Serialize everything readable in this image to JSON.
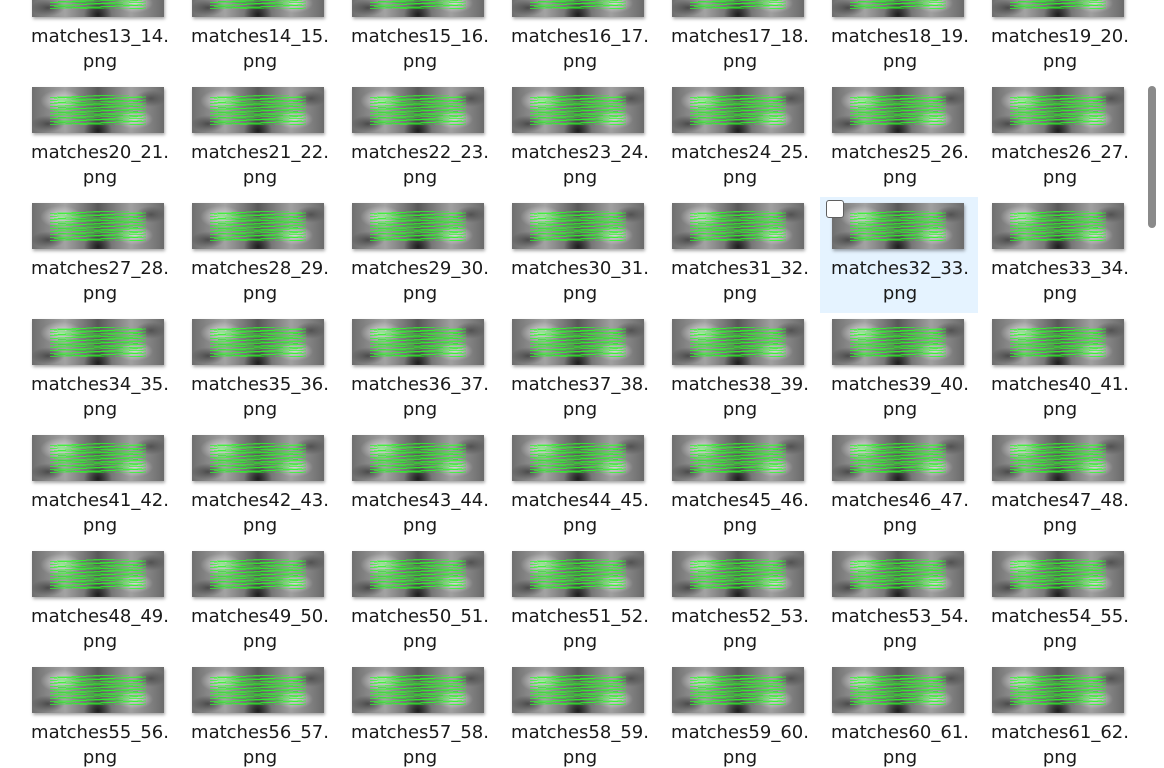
{
  "files": [
    {
      "name": "matches13_14.",
      "ext": "png"
    },
    {
      "name": "matches14_15.",
      "ext": "png"
    },
    {
      "name": "matches15_16.",
      "ext": "png"
    },
    {
      "name": "matches16_17.",
      "ext": "png"
    },
    {
      "name": "matches17_18.",
      "ext": "png"
    },
    {
      "name": "matches18_19.",
      "ext": "png"
    },
    {
      "name": "matches19_20.",
      "ext": "png"
    },
    {
      "name": "matches20_21.",
      "ext": "png"
    },
    {
      "name": "matches21_22.",
      "ext": "png"
    },
    {
      "name": "matches22_23.",
      "ext": "png"
    },
    {
      "name": "matches23_24.",
      "ext": "png"
    },
    {
      "name": "matches24_25.",
      "ext": "png"
    },
    {
      "name": "matches25_26.",
      "ext": "png"
    },
    {
      "name": "matches26_27.",
      "ext": "png"
    },
    {
      "name": "matches27_28.",
      "ext": "png"
    },
    {
      "name": "matches28_29.",
      "ext": "png"
    },
    {
      "name": "matches29_30.",
      "ext": "png"
    },
    {
      "name": "matches30_31.",
      "ext": "png"
    },
    {
      "name": "matches31_32.",
      "ext": "png"
    },
    {
      "name": "matches32_33.",
      "ext": "png",
      "selected": true
    },
    {
      "name": "matches33_34.",
      "ext": "png"
    },
    {
      "name": "matches34_35.",
      "ext": "png"
    },
    {
      "name": "matches35_36.",
      "ext": "png"
    },
    {
      "name": "matches36_37.",
      "ext": "png"
    },
    {
      "name": "matches37_38.",
      "ext": "png"
    },
    {
      "name": "matches38_39.",
      "ext": "png"
    },
    {
      "name": "matches39_40.",
      "ext": "png"
    },
    {
      "name": "matches40_41.",
      "ext": "png"
    },
    {
      "name": "matches41_42.",
      "ext": "png"
    },
    {
      "name": "matches42_43.",
      "ext": "png"
    },
    {
      "name": "matches43_44.",
      "ext": "png"
    },
    {
      "name": "matches44_45.",
      "ext": "png"
    },
    {
      "name": "matches45_46.",
      "ext": "png"
    },
    {
      "name": "matches46_47.",
      "ext": "png"
    },
    {
      "name": "matches47_48.",
      "ext": "png"
    },
    {
      "name": "matches48_49.",
      "ext": "png"
    },
    {
      "name": "matches49_50.",
      "ext": "png"
    },
    {
      "name": "matches50_51.",
      "ext": "png"
    },
    {
      "name": "matches51_52.",
      "ext": "png"
    },
    {
      "name": "matches52_53.",
      "ext": "png"
    },
    {
      "name": "matches53_54.",
      "ext": "png"
    },
    {
      "name": "matches54_55.",
      "ext": "png"
    },
    {
      "name": "matches55_56.",
      "ext": "png"
    },
    {
      "name": "matches56_57.",
      "ext": "png"
    },
    {
      "name": "matches57_58.",
      "ext": "png"
    },
    {
      "name": "matches58_59.",
      "ext": "png"
    },
    {
      "name": "matches59_60.",
      "ext": "png"
    },
    {
      "name": "matches60_61.",
      "ext": "png"
    },
    {
      "name": "matches61_62.",
      "ext": "png"
    }
  ],
  "colors": {
    "selection_background": "#e5f3ff",
    "match_lines": "#28ff28",
    "scroll_thumb": "#8a8a8a"
  },
  "icons": {
    "selection_checkbox": "checkbox-icon"
  }
}
